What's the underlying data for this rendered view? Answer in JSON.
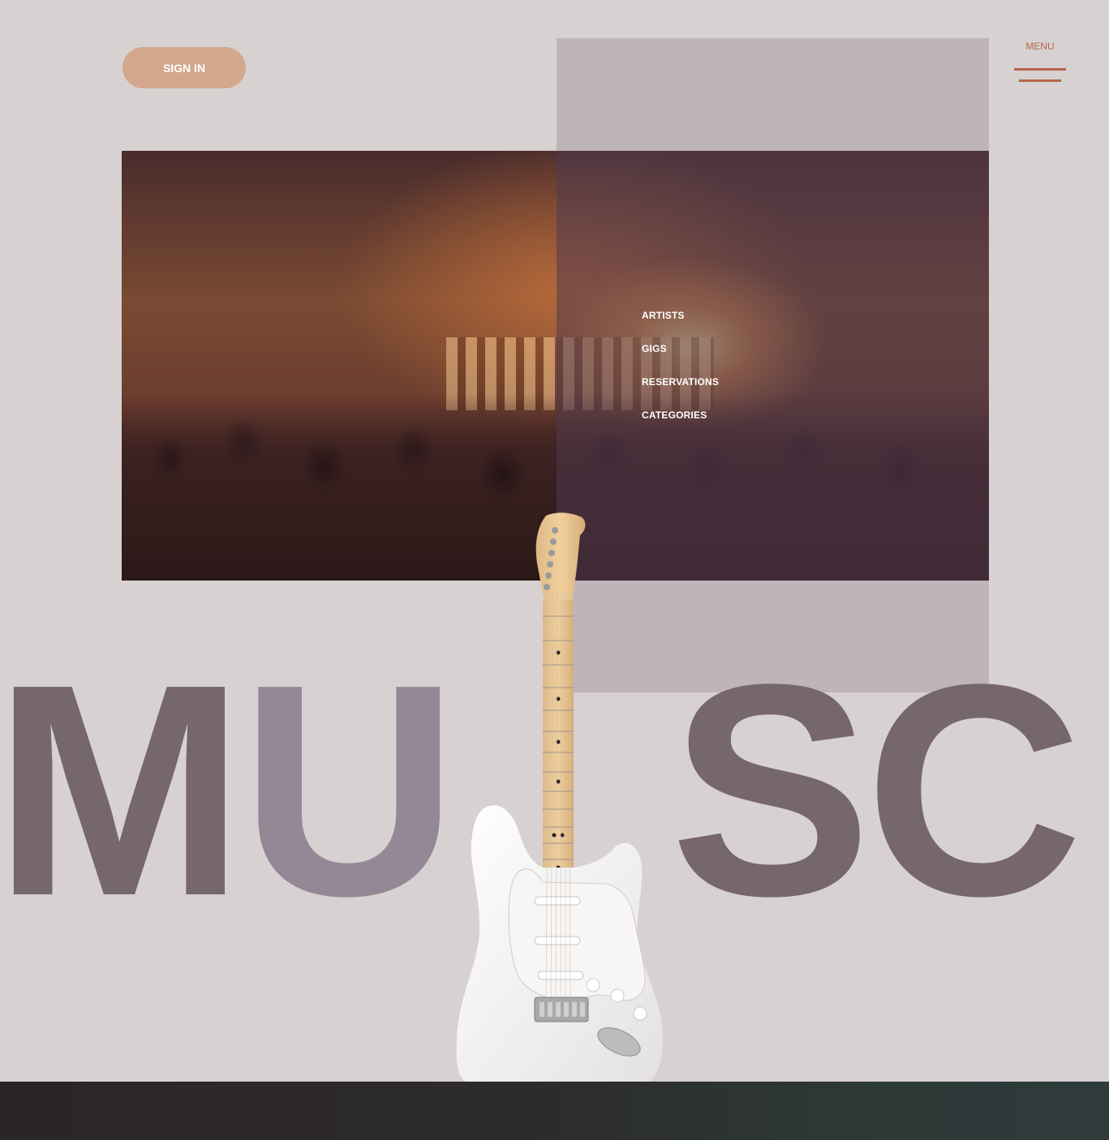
{
  "header": {
    "sign_in_label": "SIGN IN",
    "menu_label": "MENU"
  },
  "nav": {
    "items": [
      {
        "label": "ARTISTS"
      },
      {
        "label": "GIGS"
      },
      {
        "label": "RESERVATIONS"
      },
      {
        "label": "CATEGORIES"
      }
    ]
  },
  "hero": {
    "title_left": "MU",
    "title_right": "SC"
  },
  "colors": {
    "background": "#d8d1d1",
    "accent": "#b5644a",
    "button": "#d4a88d",
    "mauve_panel": "#bfb4b9",
    "title_dark": "#75676d",
    "title_light": "#958896",
    "footer": "#2b2626"
  },
  "icons": {
    "menu": "hamburger-icon"
  }
}
